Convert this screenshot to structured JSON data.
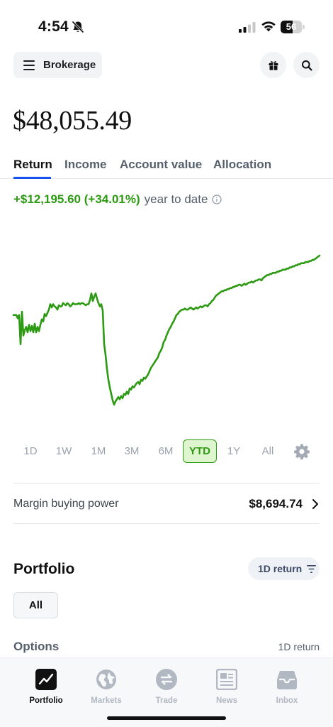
{
  "status_bar": {
    "time": "4:54",
    "battery_level": "56",
    "icons": [
      "bell-slash-icon",
      "cellular-signal-icon",
      "wifi-icon",
      "battery-icon"
    ]
  },
  "header": {
    "account_selector_label": "Brokerage",
    "icons": [
      "menu-icon",
      "gift-icon",
      "search-icon"
    ]
  },
  "balance": {
    "total": "$48,055.49"
  },
  "tabs": [
    {
      "label": "Return",
      "active": true
    },
    {
      "label": "Income",
      "active": false
    },
    {
      "label": "Account value",
      "active": false
    },
    {
      "label": "Allocation",
      "active": false
    }
  ],
  "return_summary": {
    "value": "+$12,195.60 (+34.01%)",
    "period": "year to date",
    "value_color": "#2c9a12"
  },
  "chart_data": {
    "type": "line",
    "title": "",
    "xlabel": "",
    "ylabel": "",
    "series": [
      {
        "values": [
          0.55,
          0.55,
          0.55,
          0.58,
          0.55,
          0.82,
          0.52,
          0.74,
          0.69,
          0.66,
          0.71,
          0.64,
          0.7,
          0.65,
          0.71,
          0.63,
          0.71,
          0.66,
          0.7,
          0.64,
          0.59,
          0.61,
          0.54,
          0.56,
          0.53,
          0.5,
          0.45,
          0.48,
          0.45,
          0.47,
          0.48,
          0.5,
          0.46,
          0.47,
          0.47,
          0.44,
          0.45,
          0.46,
          0.44,
          0.45,
          0.47,
          0.46,
          0.44,
          0.45,
          0.45,
          0.45,
          0.44,
          0.45,
          0.44,
          0.44,
          0.45,
          0.46,
          0.45,
          0.45,
          0.41,
          0.35,
          0.42,
          0.38,
          0.35,
          0.4,
          0.44,
          0.47,
          0.45,
          0.51,
          0.82,
          0.92,
          1.05,
          1.15,
          1.22,
          1.28,
          1.34,
          1.38,
          1.35,
          1.33,
          1.31,
          1.33,
          1.3,
          1.32,
          1.28,
          1.29,
          1.26,
          1.28,
          1.23,
          1.24,
          1.21,
          1.22,
          1.2,
          1.18,
          1.17,
          1.19,
          1.15,
          1.16,
          1.13,
          1.14,
          1.12,
          1.1,
          1.07,
          1.04,
          1.02,
          1.0,
          0.98,
          0.96,
          0.94,
          0.9,
          0.88,
          0.85,
          0.8,
          0.78,
          0.74,
          0.71,
          0.68,
          0.66,
          0.63,
          0.61,
          0.58,
          0.55,
          0.54,
          0.52,
          0.51,
          0.5,
          0.5,
          0.49,
          0.5,
          0.5,
          0.49,
          0.48,
          0.49,
          0.5,
          0.49,
          0.48,
          0.49,
          0.48,
          0.47,
          0.48,
          0.47,
          0.46,
          0.46,
          0.47,
          0.45,
          0.44,
          0.42,
          0.41,
          0.39,
          0.37,
          0.36,
          0.35,
          0.34,
          0.33,
          0.33,
          0.32,
          0.32,
          0.31,
          0.31,
          0.3,
          0.3,
          0.29,
          0.29,
          0.28,
          0.28,
          0.27,
          0.27,
          0.28,
          0.27,
          0.26,
          0.27,
          0.26,
          0.25,
          0.25,
          0.24,
          0.25,
          0.24,
          0.23,
          0.23,
          0.22,
          0.22,
          0.23,
          0.21,
          0.2,
          0.19,
          0.18,
          0.18,
          0.17,
          0.17,
          0.16,
          0.16,
          0.16,
          0.15,
          0.15,
          0.14,
          0.14,
          0.13,
          0.13,
          0.13,
          0.12,
          0.12,
          0.11,
          0.11,
          0.1,
          0.1,
          0.09,
          0.09,
          0.08,
          0.08,
          0.07,
          0.07,
          0.07,
          0.06,
          0.06,
          0.06,
          0.05,
          0.05,
          0.04,
          0.04,
          0.03,
          0.02,
          0.01,
          0.0
        ],
        "color": "#2c9a12"
      }
    ],
    "grid": false,
    "legend": "none"
  },
  "time_ranges": [
    {
      "label": "1D",
      "selected": false
    },
    {
      "label": "1W",
      "selected": false
    },
    {
      "label": "1M",
      "selected": false
    },
    {
      "label": "3M",
      "selected": false
    },
    {
      "label": "6M",
      "selected": false
    },
    {
      "label": "YTD",
      "selected": true
    },
    {
      "label": "1Y",
      "selected": false
    },
    {
      "label": "All",
      "selected": false
    }
  ],
  "margin": {
    "label": "Margin buying power",
    "value": "$8,694.74"
  },
  "portfolio": {
    "title": "Portfolio",
    "sort_label": "1D return",
    "filter_chip": "All",
    "section_label": "Options",
    "section_return_label": "1D return"
  },
  "bottom_nav": [
    {
      "label": "Portfolio",
      "icon": "chart-line-icon",
      "active": true
    },
    {
      "label": "Markets",
      "icon": "globe-icon",
      "active": false
    },
    {
      "label": "Trade",
      "icon": "swap-icon",
      "active": false
    },
    {
      "label": "News",
      "icon": "newspaper-icon",
      "active": false
    },
    {
      "label": "Inbox",
      "icon": "inbox-icon",
      "active": false
    }
  ],
  "colors": {
    "accent": "#1652f0",
    "positive": "#2c9a12",
    "muted_text": "#56606d"
  }
}
